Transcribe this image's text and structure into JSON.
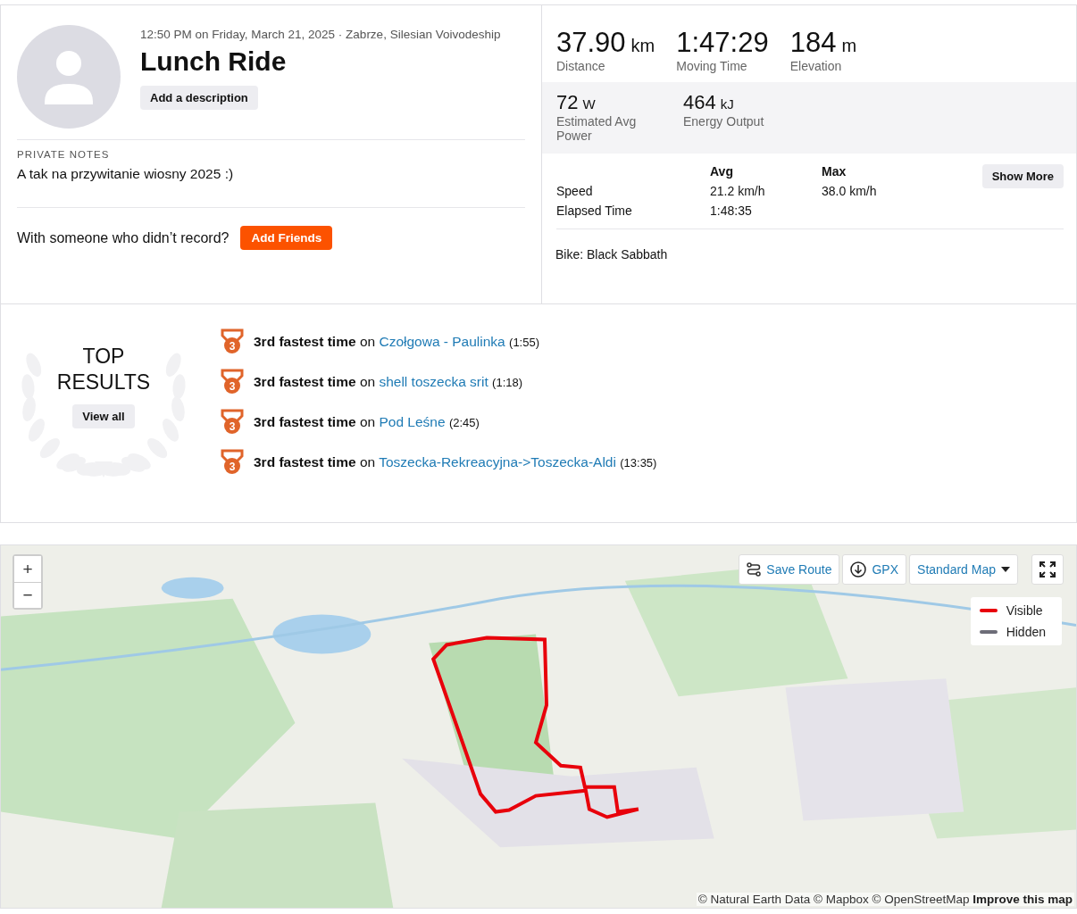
{
  "activity": {
    "meta": "12:50 PM on Friday, March 21, 2025 · Zabrze, Silesian Voivodeship",
    "title": "Lunch Ride",
    "description_button": "Add a description",
    "notes_label": "PRIVATE NOTES",
    "notes": "A tak na przywitanie wiosny 2025 :)",
    "friends_prompt": "With someone who didn’t record?",
    "friends_button": "Add Friends"
  },
  "primary_stats": [
    {
      "value": "37.90",
      "unit": "km",
      "label": "Distance"
    },
    {
      "value": "1:47:29",
      "label": "Moving Time"
    },
    {
      "value": "184",
      "unit": "m",
      "label": "Elevation"
    }
  ],
  "secondary_stats": [
    {
      "value": "72",
      "unit": "W",
      "label": "Estimated Avg Power"
    },
    {
      "value": "464",
      "unit": "kJ",
      "label": "Energy Output"
    }
  ],
  "details": {
    "columns": [
      "Avg",
      "Max"
    ],
    "show_more": "Show More",
    "rows": [
      {
        "label": "Speed",
        "avg": "21.2 km/h",
        "max": "38.0 km/h"
      },
      {
        "label": "Elapsed Time",
        "avg": "1:48:35"
      }
    ],
    "bike": "Bike: Black Sabbath"
  },
  "top_results": {
    "title_1": "TOP",
    "title_2": "RESULTS",
    "view_all": "View all",
    "items": [
      {
        "rank": "3",
        "achievement": "3rd fastest time",
        "connector": "on",
        "segment": "Czołgowa - Paulinka",
        "time": "(1:55)"
      },
      {
        "rank": "3",
        "achievement": "3rd fastest time",
        "connector": "on",
        "segment": "shell toszecka srit",
        "time": "(1:18)"
      },
      {
        "rank": "3",
        "achievement": "3rd fastest time",
        "connector": "on",
        "segment": "Pod Leśne",
        "time": "(2:45)"
      },
      {
        "rank": "3",
        "achievement": "3rd fastest time",
        "connector": "on",
        "segment": "Toszecka-Rekreacyjna->Toszecka-Aldi",
        "time": "(13:35)"
      }
    ]
  },
  "map": {
    "kind": "picture",
    "zoom_in": "+",
    "zoom_out": "−",
    "save_route": "Save Route",
    "gpx": "GPX",
    "map_style": "Standard Map",
    "legend": [
      {
        "label": "Visible",
        "color": "#e8000b"
      },
      {
        "label": "Hidden",
        "color": "#6d6d78"
      }
    ],
    "attribution": "© Natural Earth Data © Mapbox © OpenStreetMap",
    "improve_link": "Improve this map"
  }
}
